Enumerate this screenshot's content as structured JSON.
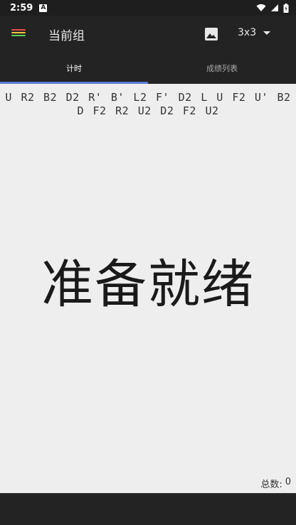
{
  "status_bar": {
    "time": "2:59",
    "notification_icon": "a-icon"
  },
  "app_bar": {
    "menu_icon": "hamburger-icon",
    "title": "当前组",
    "image_icon": "image-icon",
    "puzzle": "3x3",
    "accent_colors": [
      "#e64a4a",
      "#f5c542",
      "#5bd35b"
    ]
  },
  "tabs": [
    {
      "label": "计时",
      "active": true
    },
    {
      "label": "成绩列表",
      "active": false
    }
  ],
  "tab_indicator_color": "#5a78d6",
  "scramble": "U R2 B2 D2 R' B' L2 F' D2 L U F2 U' B2 D F2 R2 U2 D2 F2 U2",
  "timer_text": "准备就绪",
  "stats": {
    "total_label": "总数:",
    "total_value": "0"
  }
}
